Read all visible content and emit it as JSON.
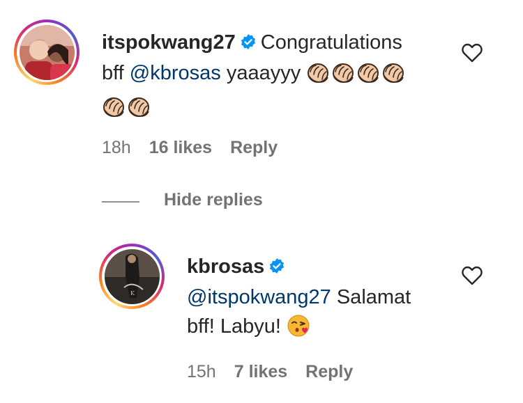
{
  "comments": [
    {
      "username": "itspokwang27",
      "verified": true,
      "text_lines": [
        {
          "prefix": "Congratulations"
        },
        {
          "prefix": "bff",
          "mention": "@kbrosas",
          "suffix": "yaaayyy"
        }
      ],
      "emoji_name": "clapping-hands-icon",
      "emoji_count": 6,
      "time": "18h",
      "likes": "16 likes",
      "reply": "Reply"
    }
  ],
  "hide_replies_label": "Hide replies",
  "replies": [
    {
      "username": "kbrosas",
      "verified": true,
      "mention": "@itspokwang27",
      "text_line1": "Salamat",
      "text_line2": "bff! Labyu!",
      "emoji_name": "kissing-face-icon",
      "time": "15h",
      "likes": "7 likes",
      "reply": "Reply"
    }
  ],
  "colors": {
    "verified": "#0095f6",
    "mention": "#00376b",
    "meta": "#737373",
    "text": "#262626"
  }
}
